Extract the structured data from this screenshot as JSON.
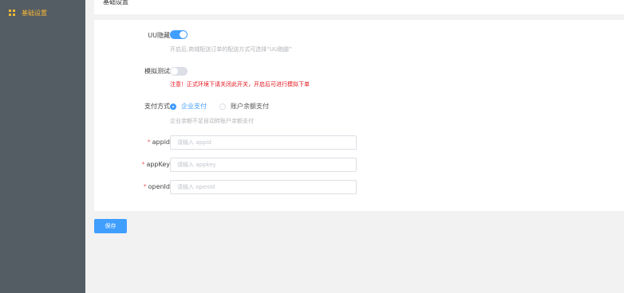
{
  "sidebar": {
    "items": [
      {
        "label": "基础设置",
        "icon": "grid-icon",
        "active": true
      }
    ],
    "active_color": "#f5b933",
    "background": "#545c64"
  },
  "header": {
    "title": "基础设置"
  },
  "form": {
    "uu_hide": {
      "label": "UU隐藏",
      "enabled": true,
      "hint": "开启后,商城配送订单的配送方式可选择“UU跑腿”"
    },
    "simulate_test": {
      "label": "模拟测试",
      "enabled": false,
      "warning": "注意！正式环境下请关闭此开关，开启后可进行模拟下单"
    },
    "payment_method": {
      "label": "支付方式",
      "options": [
        {
          "label": "企业支付",
          "checked": true
        },
        {
          "label": "账户余额支付",
          "checked": false
        }
      ],
      "hint": "企业余额不足自动转账户余额支付"
    },
    "appid": {
      "label": "appid",
      "required_mark": "*",
      "value": "",
      "placeholder": "请输入 appid"
    },
    "appkey": {
      "label": "appKey",
      "required_mark": "*",
      "value": "",
      "placeholder": "请输入 appkey"
    },
    "openid": {
      "label": "openId",
      "required_mark": "*",
      "value": "",
      "placeholder": "请输入 openId"
    }
  },
  "actions": {
    "save_label": "保存"
  },
  "colors": {
    "primary": "#409eff",
    "warning": "#e6161f",
    "required": "#f56c6c"
  }
}
